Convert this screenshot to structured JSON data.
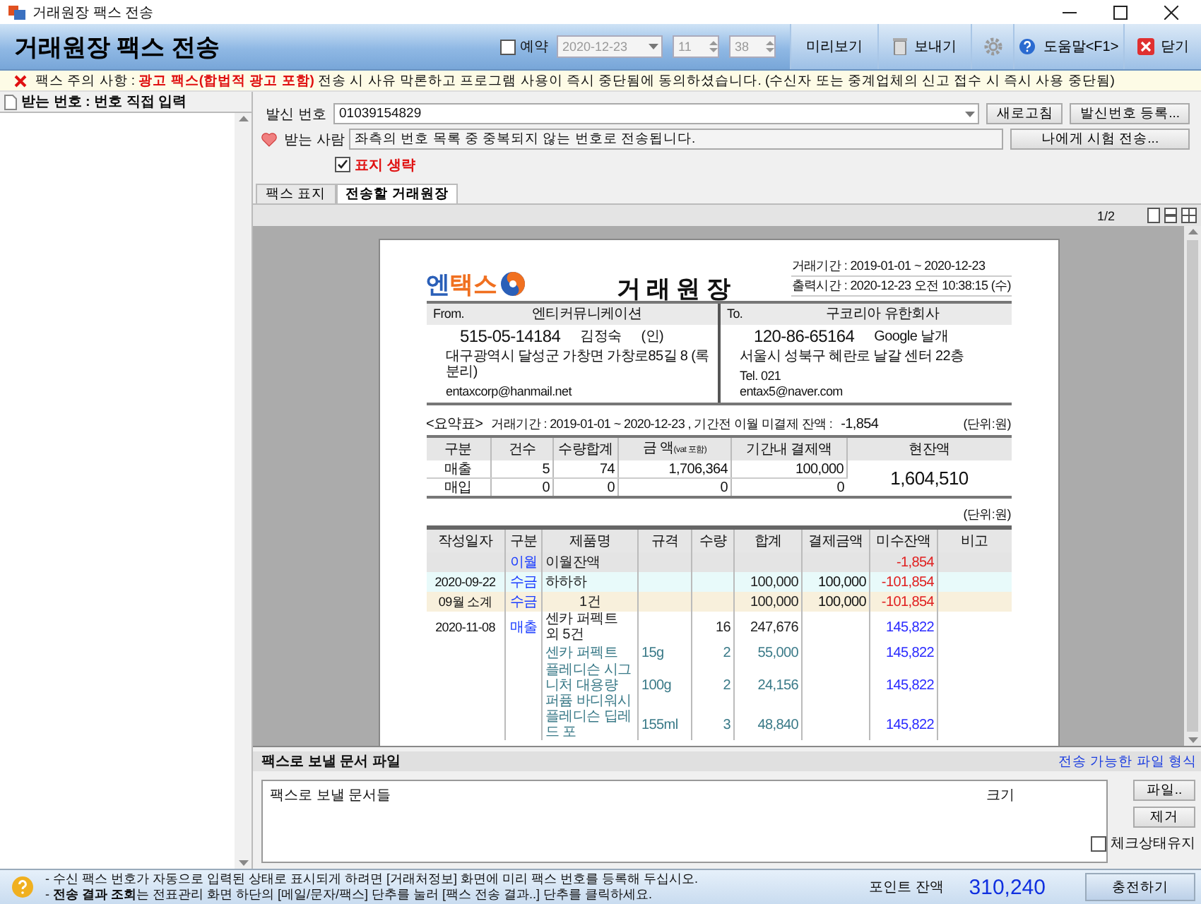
{
  "window": {
    "title": "거래원장 팩스 전송"
  },
  "header": {
    "title": "거래원장 팩스 전송",
    "reserve": {
      "label": "예약",
      "checked": false
    },
    "date": "2020-12-23",
    "hour": "11",
    "minute": "38",
    "buttons": [
      {
        "kind": "preview",
        "label": "미리보기"
      },
      {
        "kind": "send",
        "label": "보내기"
      },
      {
        "kind": "settings"
      },
      {
        "kind": "help",
        "label": "도움말<F1>"
      },
      {
        "kind": "close",
        "label": "닫기"
      }
    ]
  },
  "notice": "팩스 주의 사항 : **광고 팩스(합법적 광고 포함)** 전송 시 사유 막론하고 프로그램 사용이 즉시 중단됨에 동의하셨습니다. (수신자 또는 중계업체의 신고 접수 시 즉시 사용 중단됨)",
  "recipients_panel": {
    "title": "받는 번호 : 번호 직접 입력"
  },
  "sender": {
    "label": "발신 번호",
    "value": "01039154829",
    "buttons": [
      "새로고침",
      "발신번호 등록..."
    ]
  },
  "recipient": {
    "label": "받는 사람",
    "value": "좌측의 번호 목록 중 중복되지 않는 번호로 전송됩니다.",
    "button": "나에게 시험 전송..."
  },
  "omit_cover": {
    "label": "표지 생략",
    "checked": true
  },
  "tabs": [
    {
      "label": "팩스 표지",
      "selected": false
    },
    {
      "label": "전송할 거래원장",
      "selected": true
    }
  ],
  "viewer": {
    "page": "1/2"
  },
  "document": {
    "logo": "엔택스",
    "title": "거 래 원 장",
    "period": "거래기간 : 2019-01-01 ~ 2020-12-23",
    "printed": "출력시간 : 2020-12-23 오전 10:38:15 (수)",
    "from": {
      "label": "From.",
      "name": "엔티커뮤니케이션",
      "reg_no": "515-05-14184",
      "ceo": "김정숙",
      "seal": "(인)",
      "address": "대구광역시 달성군 가창면 가창로85길 8 (록분리)",
      "email": "entaxcorp@hanmail.net"
    },
    "to": {
      "label": "To.",
      "name": "구코리아 유한회사",
      "reg_no": "120-86-65164",
      "ceo": "Google 날개",
      "address": "서울시 성북구 혜란로  날갈 센터 22층",
      "tel": "Tel. 021",
      "email": "entax5@naver.com"
    },
    "summary": {
      "title": "<요약표>",
      "period": "거래기간 : 2019-01-01 ~ 2020-12-23 , 기간전 이월 미결제 잔액 :",
      "carryover": "-1,854",
      "unit": "(단위:원)",
      "columns": [
        "구분",
        "건수",
        "수량합계",
        "금 액$_{(vat 포함)}$",
        "기간내 결제액",
        "현잔액"
      ],
      "rows": [
        {
          "type": "매출",
          "count": "5",
          "qty": "74",
          "amount": "1,706,364",
          "paid": "100,000"
        },
        {
          "type": "매입",
          "count": "0",
          "qty": "0",
          "amount": "0",
          "paid": "0"
        }
      ],
      "balance": "1,604,510"
    },
    "unit": "(단위:원)",
    "detail": {
      "columns": [
        "작성일자",
        "구분",
        "제품명",
        "규격",
        "수량",
        "합계",
        "결제금액",
        "미수잔액",
        "비고"
      ],
      "rows": [
        {
          "kind": "carryover",
          "date": "",
          "type": "이월",
          "name": "이월잔액",
          "spec": "",
          "qty": "",
          "total": "",
          "paid": "",
          "balance": "-1,854"
        },
        {
          "kind": "payment",
          "date": "2020-09-22",
          "type": "수금",
          "name": "하하하",
          "spec": "",
          "qty": "",
          "total": "100,000",
          "paid": "100,000",
          "balance": "-101,854"
        },
        {
          "kind": "subtotal",
          "date": "09월 소계",
          "type": "수금",
          "name": "1건",
          "spec": "",
          "qty": "",
          "total": "100,000",
          "paid": "100,000",
          "balance": "-101,854"
        },
        {
          "kind": "sale",
          "date": "2020-11-08",
          "type": "매출",
          "name": "센카 퍼펙트 외 5건",
          "spec": "",
          "qty": "16",
          "total": "247,676",
          "paid": "",
          "balance": "145,822"
        },
        {
          "kind": "item",
          "date": "",
          "type": "",
          "name": "센카 퍼펙트",
          "spec": "15g",
          "qty": "2",
          "total": "55,000",
          "paid": "",
          "balance": "145,822"
        },
        {
          "kind": "item",
          "date": "",
          "type": "",
          "name": "플레디슨 시그니처 대용량 퍼퓸 바디워시",
          "spec": "100g",
          "qty": "2",
          "total": "24,156",
          "paid": "",
          "balance": "145,822"
        },
        {
          "kind": "item",
          "date": "",
          "type": "",
          "name": "플레디슨 딥레드 포",
          "spec": "155ml",
          "qty": "3",
          "total": "48,840",
          "paid": "",
          "balance": "145,822"
        }
      ]
    }
  },
  "files": {
    "title": "팩스로 보낼 문서 파일",
    "formats_link": "전송 가능한 파일 형식",
    "columns": [
      "팩스로 보낼 문서들",
      "크기"
    ],
    "buttons": [
      "파일..",
      "제거"
    ],
    "keep_checked": {
      "label": "체크상태유지",
      "checked": false
    }
  },
  "status": {
    "lines": [
      "- 수신 팩스 번호가 자동으로 입력된 상태로 표시되게 하려면 [거래처정보] 화면에 미리 팩스 번호를 등록해 두십시오.",
      "- **전송 결과 조회**는 전표관리 화면 하단의 [메일/문자/팩스] 단추를 눌러 [팩스 전송 결과..] 단추를 클릭하세요."
    ],
    "points_label": "포인트 잔액",
    "points": "310,240",
    "charge_button": "충전하기"
  }
}
